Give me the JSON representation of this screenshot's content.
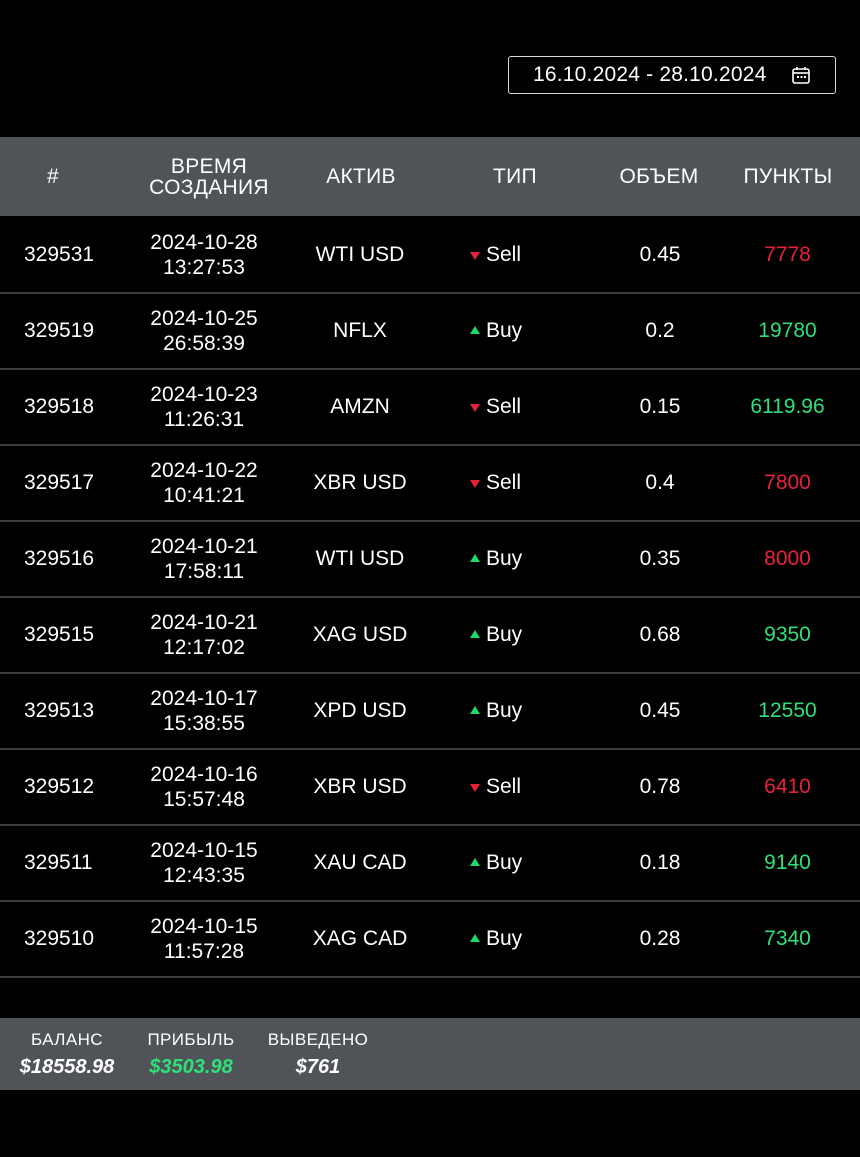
{
  "date_range": {
    "label": "16.10.2024 - 28.10.2024",
    "icon": "calendar-icon"
  },
  "table": {
    "headers": {
      "id": "#",
      "created": "ВРЕМЯ\nСОЗДАНИЯ",
      "asset": "АКТИВ",
      "type": "ТИП",
      "volume": "ОБЪЕМ",
      "points": "ПУНКТЫ"
    },
    "rows": [
      {
        "id": "329531",
        "date": "2024-10-28",
        "time": "13:27:53",
        "asset": "WTI USD",
        "type": "Sell",
        "direction": "down",
        "volume": "0.45",
        "points": "7778",
        "points_color": "negative"
      },
      {
        "id": "329519",
        "date": "2024-10-25",
        "time": "26:58:39",
        "asset": "NFLX",
        "type": "Buy",
        "direction": "up",
        "volume": "0.2",
        "points": "19780",
        "points_color": "positive"
      },
      {
        "id": "329518",
        "date": "2024-10-23",
        "time": "11:26:31",
        "asset": "AMZN",
        "type": "Sell",
        "direction": "down",
        "volume": "0.15",
        "points": "6119.96",
        "points_color": "positive"
      },
      {
        "id": "329517",
        "date": "2024-10-22",
        "time": "10:41:21",
        "asset": "XBR USD",
        "type": "Sell",
        "direction": "down",
        "volume": "0.4",
        "points": "7800",
        "points_color": "negative"
      },
      {
        "id": "329516",
        "date": "2024-10-21",
        "time": "17:58:11",
        "asset": "WTI USD",
        "type": "Buy",
        "direction": "up",
        "volume": "0.35",
        "points": "8000",
        "points_color": "negative"
      },
      {
        "id": "329515",
        "date": "2024-10-21",
        "time": "12:17:02",
        "asset": "XAG USD",
        "type": "Buy",
        "direction": "up",
        "volume": "0.68",
        "points": "9350",
        "points_color": "positive"
      },
      {
        "id": "329513",
        "date": "2024-10-17",
        "time": "15:38:55",
        "asset": "XPD USD",
        "type": "Buy",
        "direction": "up",
        "volume": "0.45",
        "points": "12550",
        "points_color": "positive"
      },
      {
        "id": "329512",
        "date": "2024-10-16",
        "time": "15:57:48",
        "asset": "XBR USD",
        "type": "Sell",
        "direction": "down",
        "volume": "0.78",
        "points": "6410",
        "points_color": "negative"
      },
      {
        "id": "329511",
        "date": "2024-10-15",
        "time": "12:43:35",
        "asset": "XAU CAD",
        "type": "Buy",
        "direction": "up",
        "volume": "0.18",
        "points": "9140",
        "points_color": "positive"
      },
      {
        "id": "329510",
        "date": "2024-10-15",
        "time": "11:57:28",
        "asset": "XAG CAD",
        "type": "Buy",
        "direction": "up",
        "volume": "0.28",
        "points": "7340",
        "points_color": "positive"
      }
    ]
  },
  "summary": {
    "balance": {
      "label": "БАЛАНС",
      "value": "$18558.98"
    },
    "profit": {
      "label": "ПРИБЫЛЬ",
      "value": "$3503.98"
    },
    "withdrawn": {
      "label": "ВЫВЕДЕНО",
      "value": "$761"
    }
  },
  "colors": {
    "positive": "#2ee07a",
    "negative": "#e8213b",
    "header_bg": "#505458",
    "background": "#000000"
  }
}
